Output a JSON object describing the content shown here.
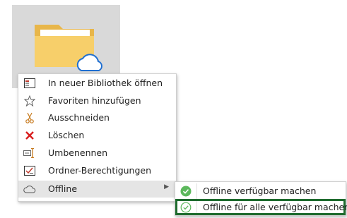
{
  "folder": {
    "icon": "folder-cloud-icon"
  },
  "context_menu": {
    "items": [
      {
        "label": "In neuer Bibliothek öffnen",
        "icon": "library-open-icon"
      },
      {
        "label": "Favoriten hinzufügen",
        "icon": "star-icon"
      },
      {
        "label": "Ausschneiden",
        "icon": "scissors-icon"
      },
      {
        "label": "Löschen",
        "icon": "delete-x-icon"
      },
      {
        "label": "Umbenennen",
        "icon": "rename-icon"
      },
      {
        "label": "Ordner-Berechtigungen",
        "icon": "permissions-icon"
      },
      {
        "label": "Offline",
        "icon": "cloud-icon",
        "has_submenu": true
      }
    ]
  },
  "submenu": {
    "items": [
      {
        "label": "Offline verfügbar machen",
        "icon": "check-circle-filled-icon"
      },
      {
        "label": "Offline für alle verfügbar machen",
        "icon": "check-circle-outline-icon",
        "highlighted": true
      }
    ]
  },
  "colors": {
    "folder_back": "#e8b64a",
    "folder_front": "#f7cf6a",
    "delete_red": "#d81e1e",
    "check_green": "#5cb85c",
    "highlight_border": "#1e6b2e",
    "hover_bg": "#e5e5e5"
  }
}
